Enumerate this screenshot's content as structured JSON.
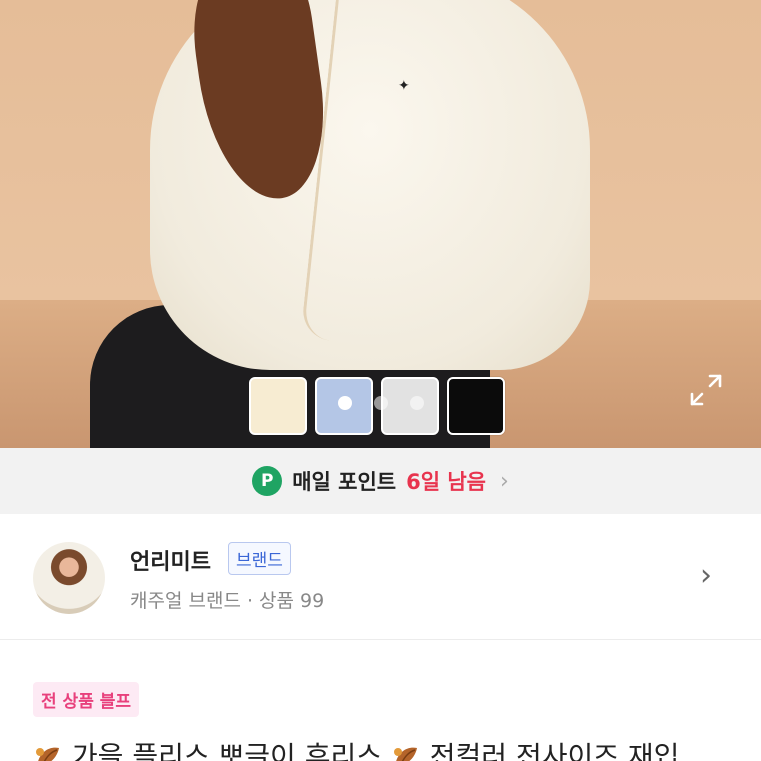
{
  "product_image": {
    "color_options": [
      {
        "name": "cream",
        "color": "#f7ecd2"
      },
      {
        "name": "light blue",
        "color": "#b4c6e6"
      },
      {
        "name": "light gray",
        "color": "#e2e2e2"
      },
      {
        "name": "black",
        "color": "#0b0b0b"
      }
    ],
    "page_dots": 3,
    "active_dot": 0
  },
  "point_banner": {
    "badge": "P",
    "label": "매일 포인트",
    "days_left": "6일 남음"
  },
  "brand": {
    "name": "언리미트",
    "tag": "브랜드",
    "subtitle": "캐주얼 브랜드 · 상품 99"
  },
  "product": {
    "promo_tag": "전 상품 블프",
    "title_part1": "가을 플리스 뽀글이 후리스",
    "title_part2": "전컬러 전사이즈 재입"
  },
  "colors": {
    "point_green": "#1fa463",
    "days_red": "#e8344e",
    "brand_tag_blue": "#3a66d6",
    "promo_pink": "#e8407c"
  }
}
